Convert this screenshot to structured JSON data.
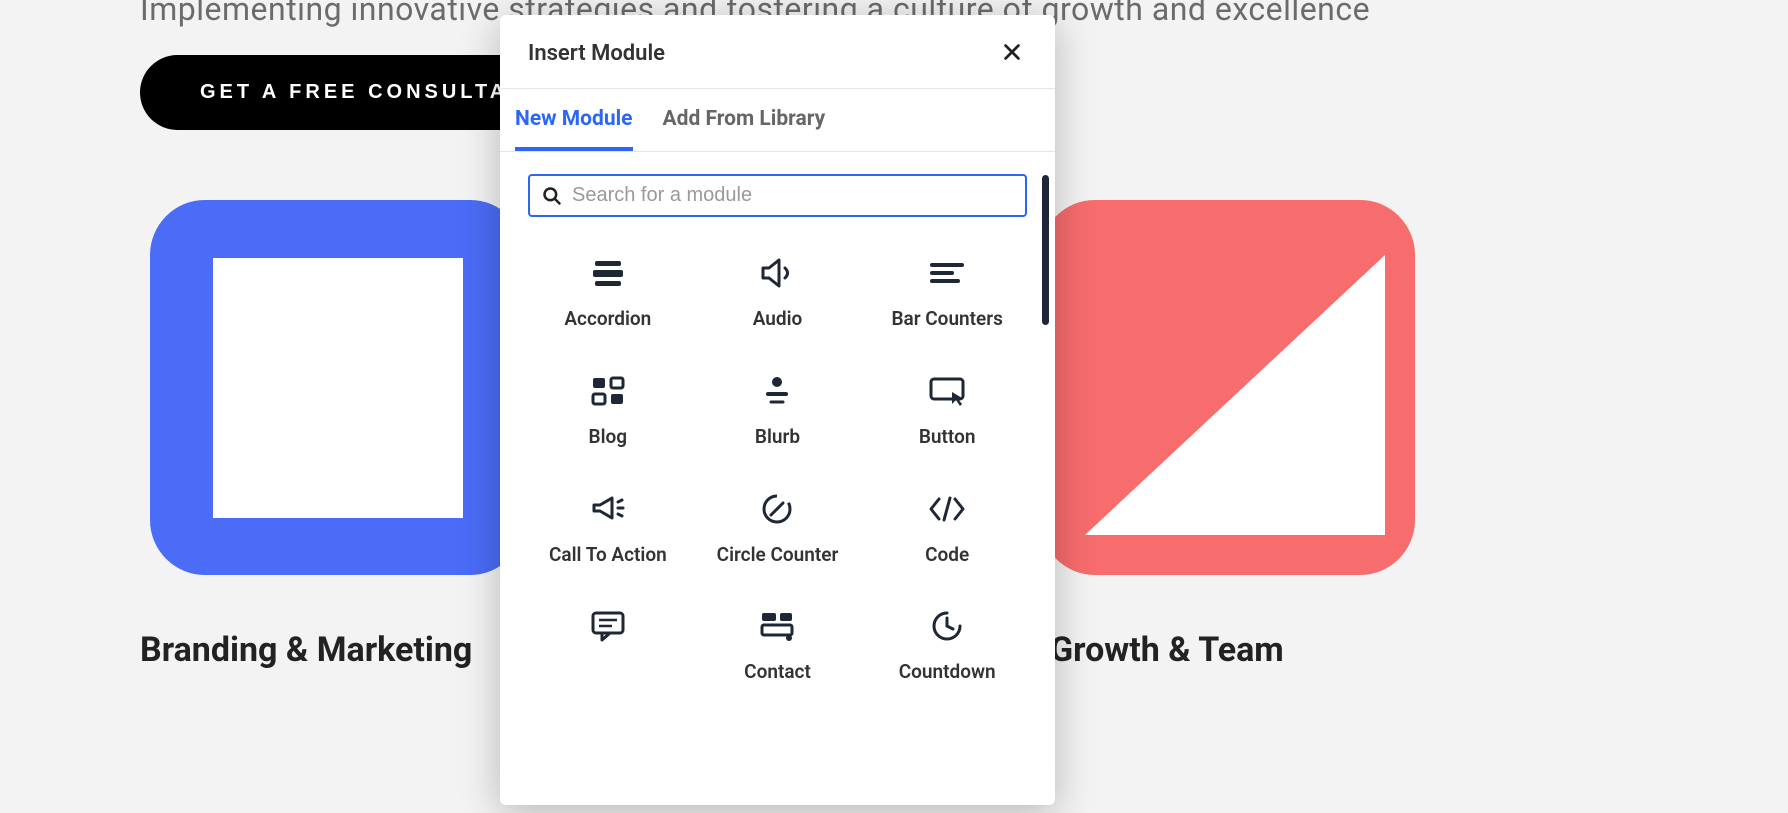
{
  "hero": {
    "subtext": "Implementing innovative strategies and fostering a culture of growth and excellence",
    "cta_label": "GET A FREE CONSULTATION"
  },
  "cards": {
    "left_title": "Branding & Marketing",
    "right_title": "Growth & Team"
  },
  "modal": {
    "title": "Insert Module",
    "tabs": {
      "new": "New Module",
      "library": "Add From Library"
    },
    "search_placeholder": "Search for a module",
    "modules": [
      {
        "icon": "accordion",
        "label": "Accordion"
      },
      {
        "icon": "audio",
        "label": "Audio"
      },
      {
        "icon": "bars",
        "label": "Bar Counters"
      },
      {
        "icon": "blog",
        "label": "Blog"
      },
      {
        "icon": "blurb",
        "label": "Blurb"
      },
      {
        "icon": "button",
        "label": "Button"
      },
      {
        "icon": "cta",
        "label": "Call To Action"
      },
      {
        "icon": "circle",
        "label": "Circle Counter"
      },
      {
        "icon": "code",
        "label": "Code"
      },
      {
        "icon": "comments",
        "label": ""
      },
      {
        "icon": "contact",
        "label": "Contact"
      },
      {
        "icon": "countdown",
        "label": "Countdown"
      }
    ]
  }
}
